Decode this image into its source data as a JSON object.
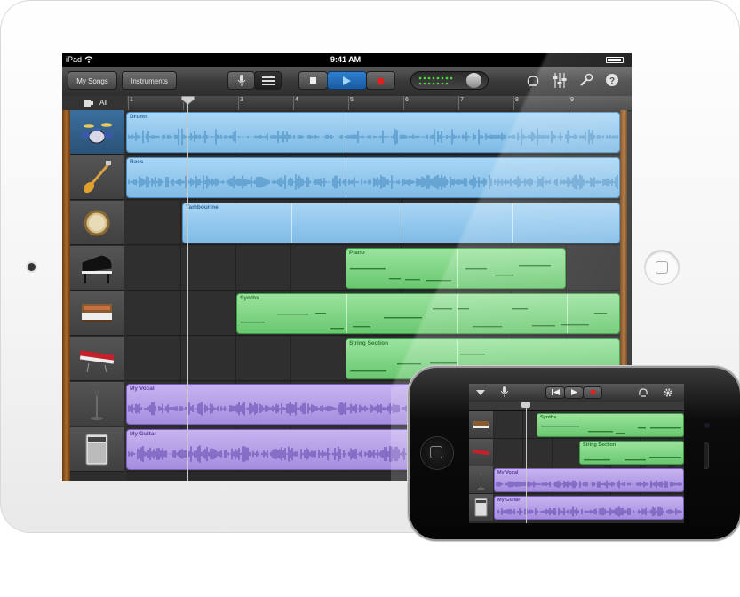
{
  "status_bar": {
    "device": "iPad",
    "time": "9:41 AM"
  },
  "toolbar": {
    "my_songs": "My Songs",
    "instruments": "Instruments",
    "icons": [
      "mic-icon",
      "tracks-view-icon",
      "stop-icon",
      "play-icon",
      "record-icon",
      "loop-icon",
      "mixer-icon",
      "settings-icon",
      "help-icon"
    ]
  },
  "ruler": {
    "all_label": "All",
    "bars": [
      "1",
      "2",
      "3",
      "4",
      "5",
      "6",
      "7",
      "8",
      "9"
    ]
  },
  "tracks": [
    {
      "instrument": "drum-kit-icon",
      "region_label": "Drums",
      "color": "blue"
    },
    {
      "instrument": "bass-guitar-icon",
      "region_label": "Bass",
      "color": "blue"
    },
    {
      "instrument": "tambourine-icon",
      "region_label": "Tambourine",
      "color": "blue"
    },
    {
      "instrument": "grand-piano-icon",
      "region_label": "Piano",
      "color": "green"
    },
    {
      "instrument": "synth-icon",
      "region_label": "Synths",
      "color": "green"
    },
    {
      "instrument": "keyboard-icon",
      "region_label": "String Section",
      "color": "green"
    },
    {
      "instrument": "microphone-icon",
      "region_label": "My Vocal",
      "color": "purple"
    },
    {
      "instrument": "amplifier-icon",
      "region_label": "My Guitar",
      "color": "purple"
    }
  ],
  "iphone": {
    "tracks": [
      {
        "region_label": "Synths",
        "color": "green"
      },
      {
        "region_label": "String Section",
        "color": "green"
      },
      {
        "region_label": "My Vocal",
        "color": "purple"
      },
      {
        "region_label": "My Guitar",
        "color": "purple"
      }
    ]
  },
  "colors": {
    "blue": "#8cc6ec",
    "green": "#7bd381",
    "purple": "#b29ce6",
    "accent": "#2d8fe0"
  }
}
